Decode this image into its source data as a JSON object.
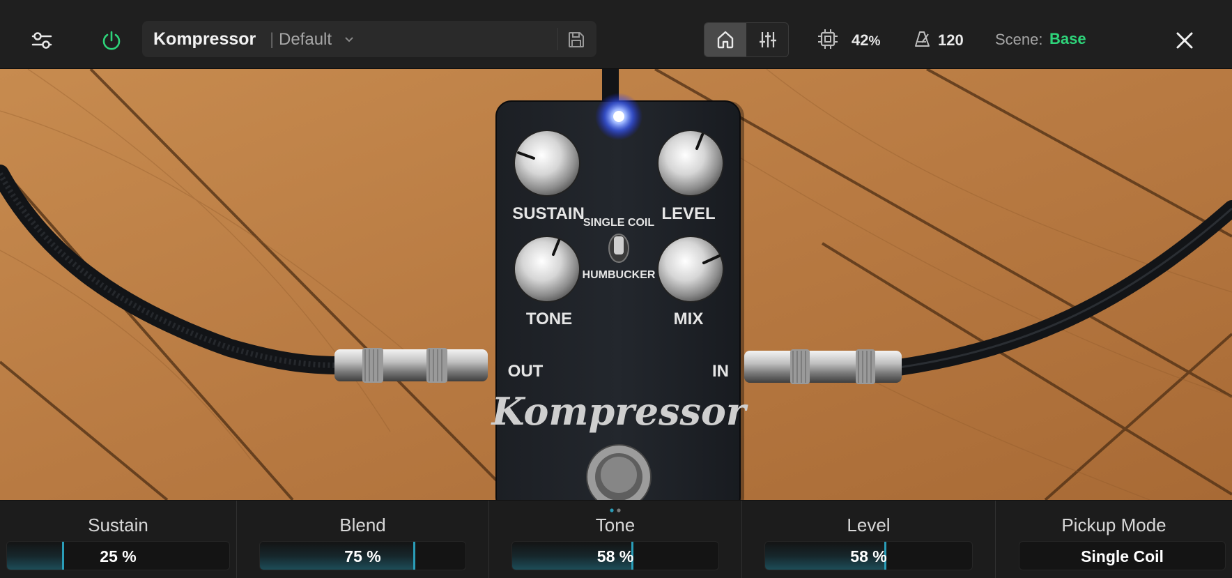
{
  "header": {
    "plugin_name": "Kompressor",
    "separator": "|",
    "preset_name": "Default",
    "cpu_value": "42",
    "cpu_unit": "%",
    "tempo_value": "120",
    "scene_label": "Scene:",
    "scene_value": "Base",
    "accent_color": "#2ed47a"
  },
  "icons": {
    "menu": "sliders-menu-icon",
    "power": "power-icon",
    "dropdown": "chevron-down-icon",
    "save": "save-icon",
    "home": "home-icon",
    "mixer": "mixer-icon",
    "cpu": "cpu-chip-icon",
    "tempo": "metronome-icon",
    "close": "close-icon"
  },
  "pedal": {
    "knob_labels": [
      "SUSTAIN",
      "LEVEL",
      "TONE",
      "MIX"
    ],
    "switch_top": "SINGLE COIL",
    "switch_bottom": "HUMBUCKER",
    "jack_out": "OUT",
    "jack_in": "IN",
    "logo": "Kompressor"
  },
  "params": [
    {
      "label": "Sustain",
      "value": "25 %",
      "level": 0.25
    },
    {
      "label": "Blend",
      "value": "75 %",
      "level": 0.75
    },
    {
      "label": "Tone",
      "value": "58 %",
      "level": 0.58
    },
    {
      "label": "Level",
      "value": "58 %",
      "level": 0.58
    },
    {
      "label": "Pickup Mode",
      "value": "Single Coil",
      "level": null
    }
  ],
  "page_dots": {
    "count": 2,
    "active": 0
  }
}
